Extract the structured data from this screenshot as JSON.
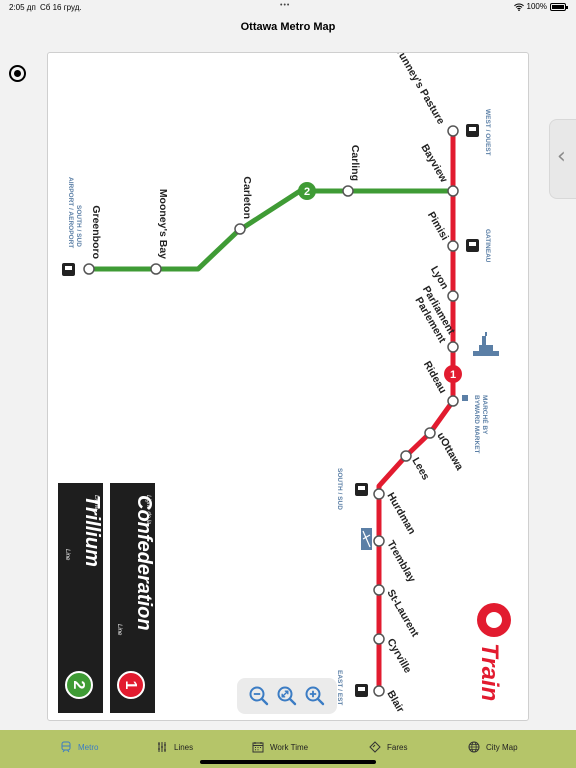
{
  "status_bar": {
    "time": "2:05 дп",
    "date": "Сб 16 груд.",
    "battery": "100%"
  },
  "nav": {
    "title": "Ottawa Metro Map"
  },
  "map": {
    "line1_color": "#e21b2f",
    "line2_color": "#3f9b35",
    "stations": [
      {
        "id": "tunneys",
        "name": "Tunney's Pasture"
      },
      {
        "id": "bayview",
        "name": "Bayview"
      },
      {
        "id": "pimisi",
        "name": "Pimisi"
      },
      {
        "id": "lyon",
        "name": "Lyon"
      },
      {
        "id": "parliament",
        "name": "Parliament\nParlement"
      },
      {
        "id": "rideau",
        "name": "Rideau"
      },
      {
        "id": "uottawa",
        "name": "uOttawa"
      },
      {
        "id": "lees",
        "name": "Lees"
      },
      {
        "id": "hurdman",
        "name": "Hurdman"
      },
      {
        "id": "tremblay",
        "name": "Tremblay"
      },
      {
        "id": "stlaurent",
        "name": "St-Laurent"
      },
      {
        "id": "cyrville",
        "name": "Cyrville"
      },
      {
        "id": "blair",
        "name": "Blair"
      },
      {
        "id": "carling",
        "name": "Carling"
      },
      {
        "id": "carleton",
        "name": "Carleton"
      },
      {
        "id": "mooneys",
        "name": "Mooney's Bay"
      },
      {
        "id": "greenboro",
        "name": "Greenboro"
      }
    ],
    "direction_labels": {
      "west": "WEST / OUEST",
      "gatineau": "GATINEAU",
      "byward": "BYWARD MARKET\nMARCHÉ BY",
      "south": "SOUTH / SUD",
      "east": "EAST / EST",
      "airport": "SOUTH / SUD\nAIRPORT / AEROPORT"
    },
    "line_badges": {
      "line1": "1",
      "line2": "2"
    },
    "legend": {
      "confederation": {
        "top": "Ligne de la",
        "name": "Confederation",
        "bottom": "Line",
        "number": "1"
      },
      "trillium": {
        "top": "Ligne",
        "name": "Trillium",
        "bottom": "Line",
        "number": "2"
      }
    },
    "logo_text": "Train"
  },
  "zoom": {
    "icons": [
      "zoom-out-icon",
      "zoom-reset-icon",
      "zoom-in-icon"
    ]
  },
  "tabs": [
    {
      "label": "Metro",
      "icon": "train-icon",
      "active": true
    },
    {
      "label": "Lines",
      "icon": "lines-icon",
      "active": false
    },
    {
      "label": "Work Time",
      "icon": "calendar-icon",
      "active": false
    },
    {
      "label": "Fares",
      "icon": "ticket-icon",
      "active": false
    },
    {
      "label": "City Map",
      "icon": "globe-icon",
      "active": false
    }
  ],
  "colors": {
    "tab_bar": "#b5c569",
    "tab_active": "#3b7cc4"
  }
}
